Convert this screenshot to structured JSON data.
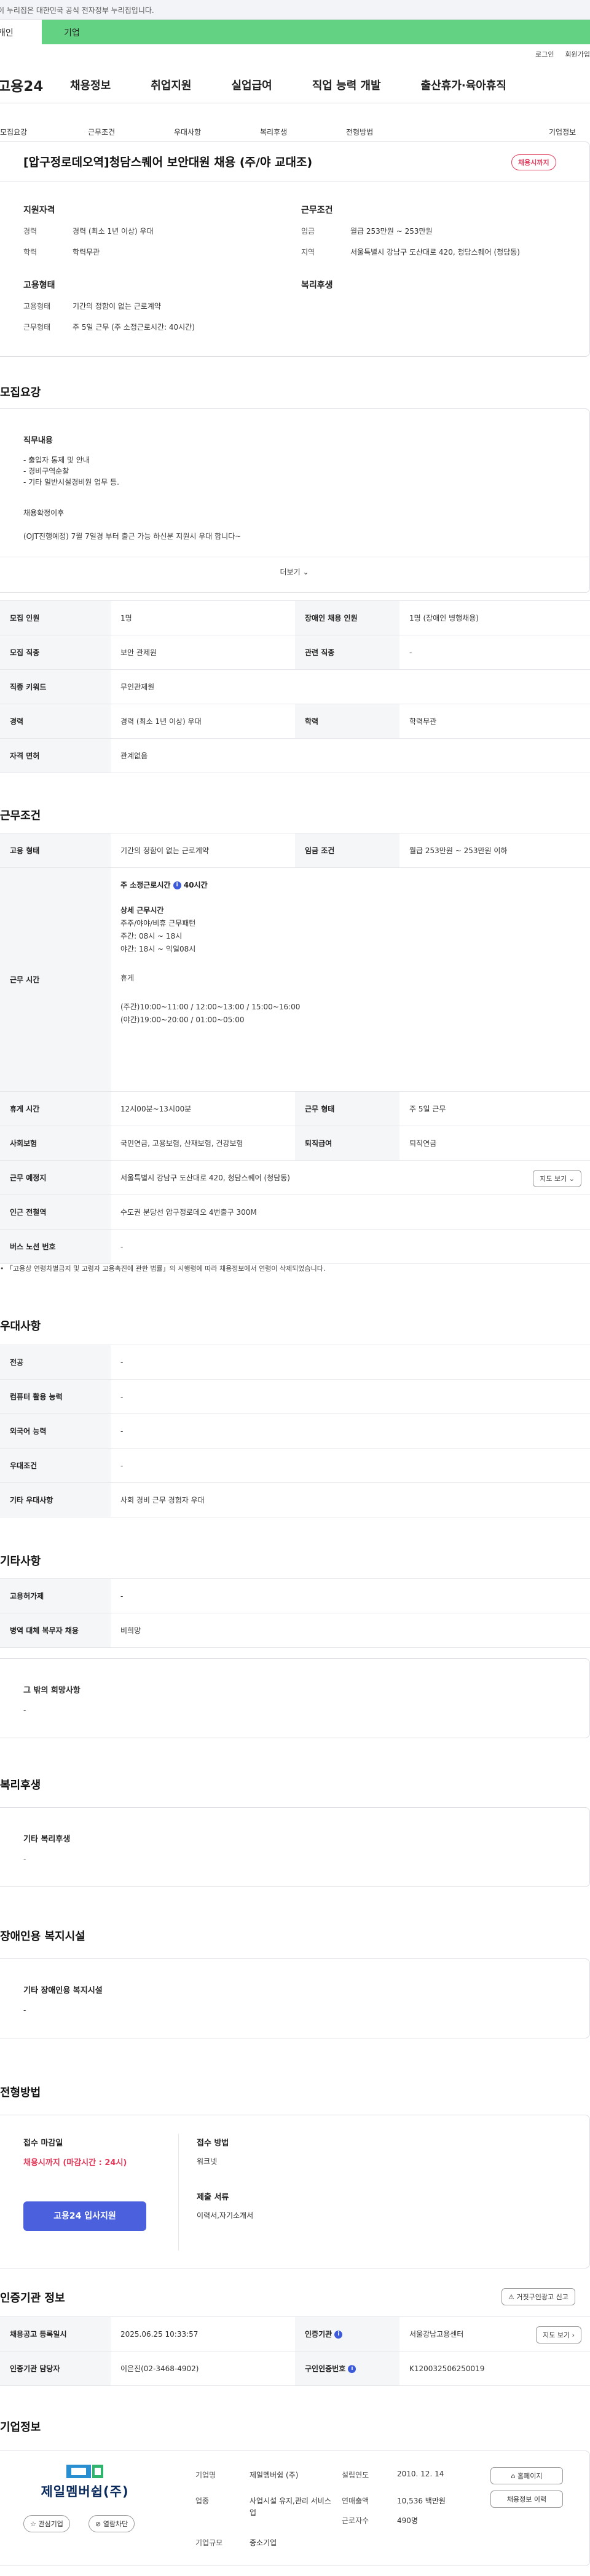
{
  "gov_banner": "이 누리집은 대한민국 공식 전자정부 누리집입니다.",
  "member_tabs": {
    "individual": "개인",
    "company": "기업"
  },
  "util": {
    "login": "로그인",
    "join": "회원가입"
  },
  "gnb": {
    "logo": "고용24",
    "menus": [
      "채용정보",
      "취업지원",
      "실업급여",
      "직업 능력 개발",
      "출산휴가·육아휴직"
    ]
  },
  "snb": [
    "모집요강",
    "근무조건",
    "우대사항",
    "복리후생",
    "전형방법",
    "기업정보"
  ],
  "title": "[압구정로데오역]청담스퀘어 보안대원 채용 (주/야 교대조)",
  "status_badge": "채용시까지",
  "summary": {
    "qual_title": "지원자격",
    "career_label": "경력",
    "career_value": "경력 (최소 1년 이상) 우대",
    "edu_label": "학력",
    "edu_value": "학력무관",
    "work_title": "근무조건",
    "wage_label": "임금",
    "wage_value": "월급 253만원 ~ 253만원",
    "loc_label": "지역",
    "loc_value": "서울특별시 강남구 도산대로 420, 청담스퀘어 (청담동)",
    "emp_title": "고용형태",
    "emptype_label": "고용형태",
    "emptype_value": "기간의 정함이 없는 근로계약",
    "worktype_label": "근무형태",
    "worktype_value": "주 5일 근무 (주 소정근로시간: 40시간)",
    "welfare_title": "복리후생"
  },
  "recruit": {
    "heading": "모집요강",
    "duty_title": "직무내용",
    "duty_lines": [
      "- 출입자 통제 및 안내",
      "- 경비구역순찰",
      "- 기타 일반시설경비원 업무 등."
    ],
    "hire_title": "채용확정이후",
    "hire_line": "(OJT진행예정) 7월 7일경 부터 출근 가능 하신분 지원시 우대 합니다~",
    "more": "더보기",
    "rows": [
      [
        "모집 인원",
        "1명",
        "장애인 채용 인원",
        "1명 (장애인 병행채용)"
      ],
      [
        "모집 직종",
        "보안 관제원",
        "관련 직종",
        "-"
      ],
      [
        "직종 키워드",
        "무인관제원",
        "",
        ""
      ],
      [
        "경력",
        "경력 (최소 1년 이상) 우대",
        "학력",
        "학력무관"
      ],
      [
        "자격 면허",
        "관계없음",
        "",
        ""
      ]
    ]
  },
  "conditions": {
    "heading": "근무조건",
    "emp_label": "고용 형태",
    "emp_value": "기간의 정함이 없는 근로계약",
    "wage_label": "임금 조건",
    "wage_value": "월급 253만원 ~ 253만원 이하",
    "hours_label": "근무 시간",
    "weekly": "주 소정근로시간",
    "weekly_value": "40시간",
    "detail_title": "상세 근무시간",
    "detail_lines": [
      "주주/야야/비휴 근무패턴",
      "주간: 08시 ~ 18시",
      "야간: 18시 ~ 익일08시"
    ],
    "rest_title": "휴게",
    "rest_lines": [
      "(주간)10:00~11:00 / 12:00~13:00 / 15:00~16:00",
      "(야간)19:00~20:00 / 01:00~05:00"
    ],
    "rows": [
      [
        "휴게 시간",
        "12시00분~13시00분",
        "근무 형태",
        "주 5일 근무"
      ],
      [
        "사회보험",
        "국민연금, 고용보험, 산재보험, 건강보험",
        "퇴직급여",
        "퇴직연금"
      ],
      [
        "근무 예정지",
        "서울특별시 강남구 도산대로 420, 청담스퀘어 (청담동)",
        "",
        ""
      ],
      [
        "인근 전철역",
        "수도권 분당선 압구정로데오 4번출구 300M",
        "",
        ""
      ],
      [
        "버스 노선 번호",
        "-",
        "",
        ""
      ]
    ],
    "map_btn": "지도 보기",
    "note": "「고용상 연령차별금지 및 고령자 고용촉진에 관한 법률」의 시행령에 따라 채용정보에서 연령이 삭제되었습니다."
  },
  "preference": {
    "heading": "우대사항",
    "rows": [
      [
        "전공",
        "-"
      ],
      [
        "컴퓨터 활용 능력",
        "-"
      ],
      [
        "외국어 능력",
        "-"
      ],
      [
        "우대조건",
        "-"
      ],
      [
        "기타 우대사항",
        "사회 경비 근무 경험자 우대"
      ]
    ]
  },
  "etc": {
    "heading": "기타사항",
    "rows": [
      [
        "고용허가제",
        "-"
      ],
      [
        "병역 대체 복무자 채용",
        "비희망"
      ]
    ],
    "card_title": "그 밖의 희망사항",
    "card_value": "-"
  },
  "welfare": {
    "heading": "복리후생",
    "card_title": "기타 복리후생",
    "card_value": "-"
  },
  "disabled": {
    "heading": "장애인용 복지시설",
    "card_title": "기타 장애인용 복지시설",
    "card_value": "-"
  },
  "selection": {
    "heading": "전형방법",
    "deadline_title": "접수 마감일",
    "deadline_value": "채용시까지 (마감시간 : 24시)",
    "method_title": "접수 방법",
    "method_value": "워크넷",
    "docs_title": "제출 서류",
    "docs_value": "이력서,자기소개서",
    "apply_btn": "고용24 입사지원"
  },
  "agency": {
    "heading": "인증기관 정보",
    "report_btn": "거짓구인광고 신고",
    "rows": [
      [
        "채용공고 등록일시",
        "2025.06.25 10:33:57",
        "인증기관",
        "서울강남고용센터"
      ],
      [
        "인증기관 담당자",
        "이은진(02-3468-4902)",
        "구인인증번호",
        "K120032506250019"
      ]
    ],
    "map_btn": "지도 보기"
  },
  "company": {
    "heading": "기업정보",
    "logo_text": "제일멤버쉽(주)",
    "fav_btn": "관심기업",
    "block_btn": "열람차단",
    "name_label": "기업명",
    "name_value": "제일멤버쉽 (주)",
    "industry_label": "업종",
    "industry_value": "사업시설 유지,관리 서비스업",
    "size_label": "기업규모",
    "size_value": "중소기업",
    "year_label": "설립연도",
    "year_value": "2010. 12. 14",
    "sales_label": "연매출액",
    "sales_value": "10,536 백만원",
    "staff_label": "근로자수",
    "staff_value": "490명",
    "home_btn": "홈페이지",
    "jobs_btn": "채용정보 이력"
  },
  "colors": {
    "accent": "#4a60dc",
    "green": "#64d283",
    "red": "#e03b5a"
  }
}
